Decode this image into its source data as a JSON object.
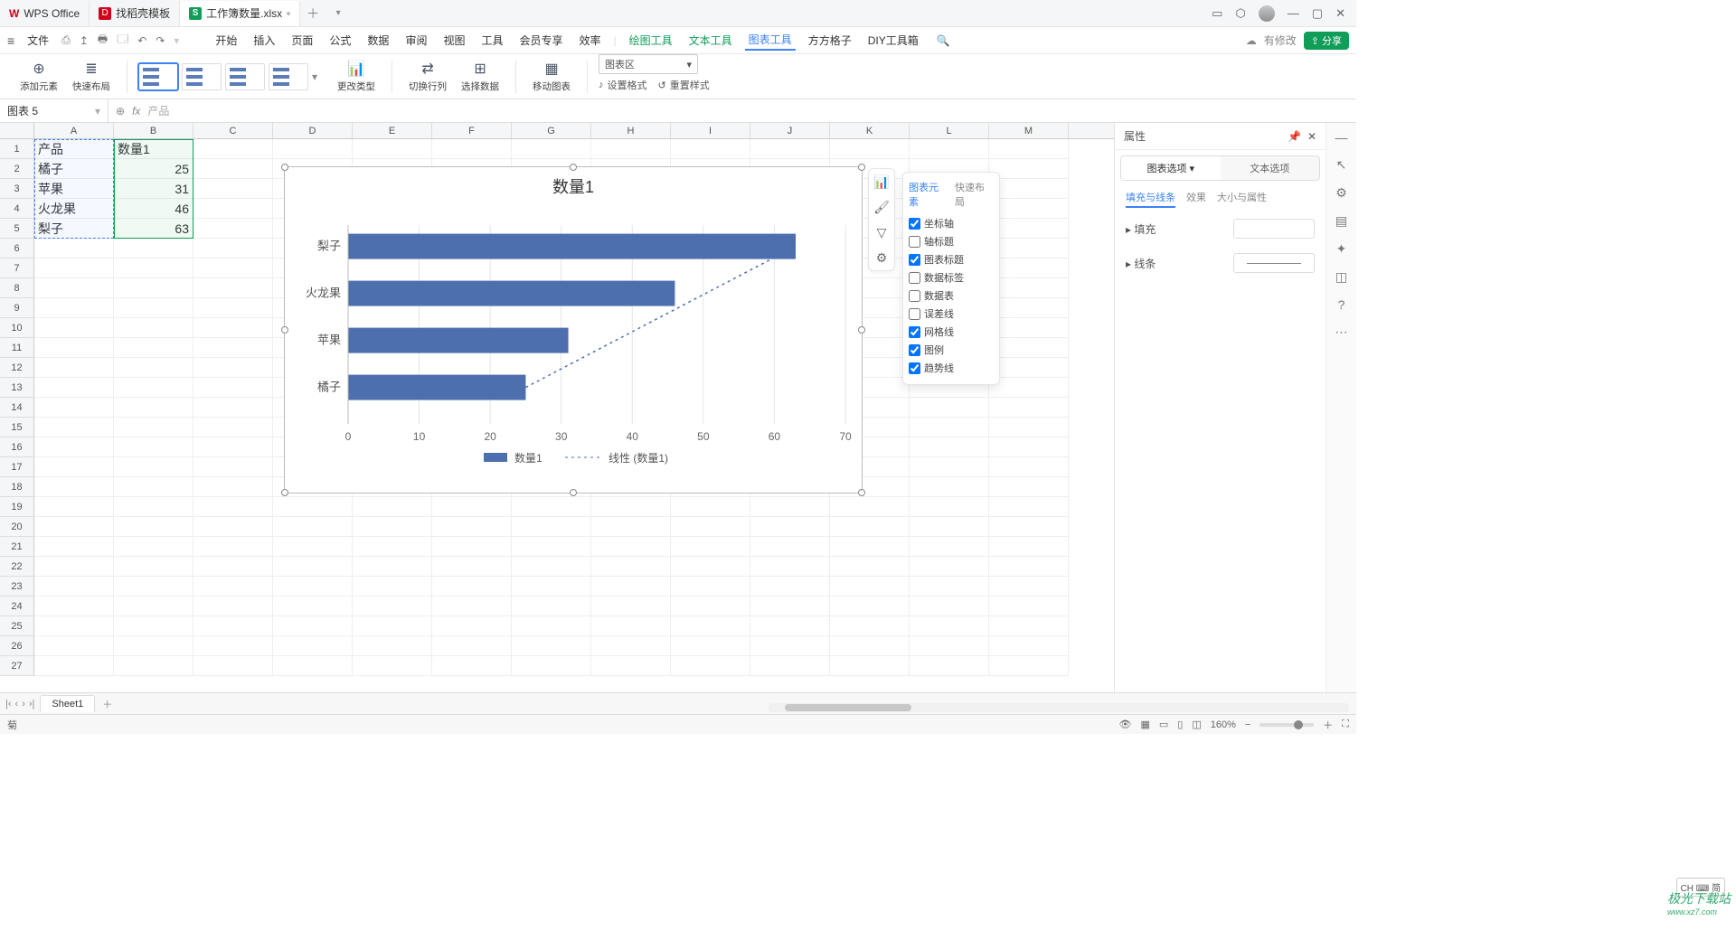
{
  "titlebar": {
    "tabs": [
      {
        "icon": "wps",
        "label": "WPS Office"
      },
      {
        "icon": "docer",
        "label": "找稻壳模板"
      },
      {
        "icon": "xls",
        "label": "工作簿数量.xlsx"
      }
    ]
  },
  "menubar": {
    "file": "文件",
    "items": [
      "开始",
      "插入",
      "页面",
      "公式",
      "数据",
      "审阅",
      "视图",
      "工具",
      "会员专享",
      "效率"
    ],
    "tool_items": [
      "绘图工具",
      "文本工具",
      "图表工具",
      "方方格子",
      "DIY工具箱"
    ],
    "active": "图表工具",
    "pending": "有修改",
    "share": "分享"
  },
  "toolbar": {
    "add_element": "添加元素",
    "quick_layout": "快速布局",
    "change_type": "更改类型",
    "swap_rc": "切换行列",
    "select_data": "选择数据",
    "move_chart": "移动图表",
    "area_select": "图表区",
    "set_format": "设置格式",
    "reset_style": "重置样式"
  },
  "namebox": {
    "value": "图表 5",
    "fx_value": "产品"
  },
  "columns": [
    "A",
    "B",
    "C",
    "D",
    "E",
    "F",
    "G",
    "H",
    "I",
    "J",
    "K",
    "L",
    "M"
  ],
  "table": {
    "headers": [
      "产品",
      "数量1"
    ],
    "rows": [
      {
        "a": "橘子",
        "b": 25
      },
      {
        "a": "苹果",
        "b": 31
      },
      {
        "a": "火龙果",
        "b": 46
      },
      {
        "a": "梨子",
        "b": 63
      }
    ]
  },
  "chart_float": {
    "tabs": [
      "图表元素",
      "快速布局"
    ],
    "items": [
      {
        "label": "坐标轴",
        "checked": true
      },
      {
        "label": "轴标题",
        "checked": false
      },
      {
        "label": "图表标题",
        "checked": true
      },
      {
        "label": "数据标签",
        "checked": false
      },
      {
        "label": "数据表",
        "checked": false
      },
      {
        "label": "误差线",
        "checked": false
      },
      {
        "label": "网格线",
        "checked": true
      },
      {
        "label": "图例",
        "checked": true
      },
      {
        "label": "趋势线",
        "checked": true
      }
    ]
  },
  "chart_data": {
    "type": "bar",
    "title": "数量1",
    "categories": [
      "梨子",
      "火龙果",
      "苹果",
      "橘子"
    ],
    "values": [
      63,
      46,
      31,
      25
    ],
    "series_name": "数量1",
    "trend_name": "线性 (数量1)",
    "xlim": [
      0,
      70
    ],
    "xticks": [
      0,
      10,
      20,
      30,
      40,
      50,
      60,
      70
    ],
    "ylabel": "",
    "xlabel": "",
    "legend": [
      "数量1",
      "线性 (数量1)"
    ]
  },
  "right_panel": {
    "title": "属性",
    "tabs": [
      "图表选项",
      "文本选项"
    ],
    "subtabs": [
      "填充与线条",
      "效果",
      "大小与属性"
    ],
    "fill": "填充",
    "line": "线条"
  },
  "sheet_tabs": {
    "name": "Sheet1"
  },
  "statusbar": {
    "zoom": "160%",
    "mode": "菊"
  },
  "ime": "CH ⌨ 简",
  "watermark": {
    "main": "极光下载站",
    "sub": "www.xz7.com"
  }
}
